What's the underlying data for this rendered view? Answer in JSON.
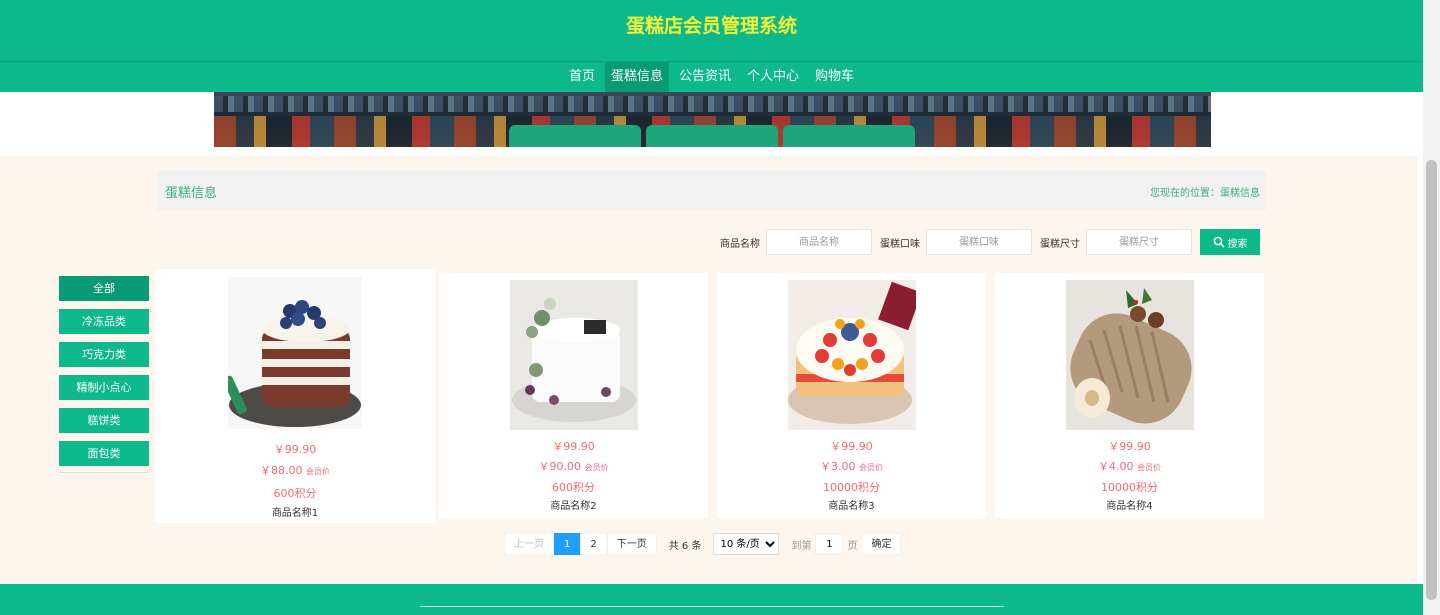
{
  "header": {
    "title": "蛋糕店会员管理系统"
  },
  "nav": [
    {
      "label": "首页"
    },
    {
      "label": "蛋糕信息",
      "active": true
    },
    {
      "label": "公告资讯"
    },
    {
      "label": "个人中心"
    },
    {
      "label": "购物车"
    }
  ],
  "page": {
    "title": "蛋糕信息",
    "location": "您现在的位置：蛋糕信息"
  },
  "search": {
    "name_label": "商品名称",
    "name_placeholder": "商品名称",
    "flavor_label": "蛋糕口味",
    "flavor_placeholder": "蛋糕口味",
    "size_label": "蛋糕尺寸",
    "size_placeholder": "蛋糕尺寸",
    "button_label": "搜索"
  },
  "categories": [
    {
      "label": "全部",
      "active": true
    },
    {
      "label": "冷冻品类"
    },
    {
      "label": "巧克力类"
    },
    {
      "label": "精制小点心"
    },
    {
      "label": "糕饼类"
    },
    {
      "label": "面包类"
    }
  ],
  "products": [
    {
      "price": "￥99.90",
      "member_price": "￥88.00",
      "member_suffix": "会员价",
      "points": "600积分",
      "name": "商品名称1",
      "image": "berry-naked-cake"
    },
    {
      "price": "￥99.90",
      "member_price": "￥90.00",
      "member_suffix": "会员价",
      "points": "600积分",
      "name": "商品名称2",
      "image": "white-floral-cake"
    },
    {
      "price": "￥99.90",
      "member_price": "￥3.00",
      "member_suffix": "会员价",
      "points": "10000积分",
      "name": "商品名称3",
      "image": "fruit-cake"
    },
    {
      "price": "￥99.90",
      "member_price": "￥4.00",
      "member_suffix": "会员价",
      "points": "10000积分",
      "name": "商品名称4",
      "image": "chestnut-roll-cake"
    }
  ],
  "pager": {
    "prev": "上一页",
    "pages": [
      "1",
      "2"
    ],
    "current": "1",
    "next": "下一页",
    "total": "共 6 条",
    "page_size": "10 条/页",
    "goto_label": "到第",
    "goto_value": "1",
    "page_unit": "页",
    "confirm": "确定"
  },
  "colors": {
    "primary": "#0db98a",
    "title": "#f2f23a",
    "price": "#ef6d6d",
    "pager_active": "#1e9fff"
  }
}
